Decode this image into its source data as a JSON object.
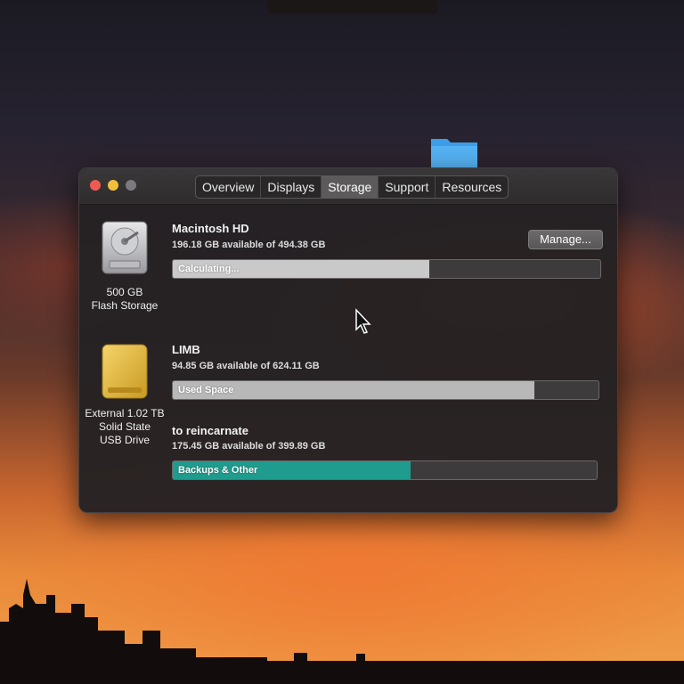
{
  "window": {
    "tabs": [
      {
        "label": "Overview",
        "active": false
      },
      {
        "label": "Displays",
        "active": false
      },
      {
        "label": "Storage",
        "active": true
      },
      {
        "label": "Support",
        "active": false
      },
      {
        "label": "Resources",
        "active": false
      }
    ]
  },
  "drives": {
    "internal": {
      "icon": "hard-drive-icon",
      "caption_line1": "500 GB",
      "caption_line2": "Flash Storage",
      "volume_name": "Macintosh HD",
      "available": "196.18 GB available of 494.38 GB",
      "bar_label": "Calculating...",
      "bar_fill_fraction": 0.6,
      "bar_color": "#c9c9c9",
      "manage_label": "Manage..."
    },
    "external": {
      "icon": "external-drive-icon",
      "caption_line1": "External 1.02 TB",
      "caption_line2": "Solid State",
      "caption_line3": "USB Drive",
      "volumes": [
        {
          "name": "LIMB",
          "available": "94.85 GB available of 624.11 GB",
          "bar_label": "Used Space",
          "bar_fill_fraction": 0.85,
          "bar_color": "#b8b8b8"
        },
        {
          "name": "to reincarnate",
          "available": "175.45 GB available of 399.89 GB",
          "bar_label": "Backups & Other",
          "bar_fill_fraction": 0.56,
          "bar_color": "#1f9c8e"
        }
      ]
    }
  },
  "colors": {
    "close": "#ee5a52",
    "minimize": "#f2bf3a",
    "zoom": "#7a7a80",
    "folder": "#3d9ee8"
  }
}
